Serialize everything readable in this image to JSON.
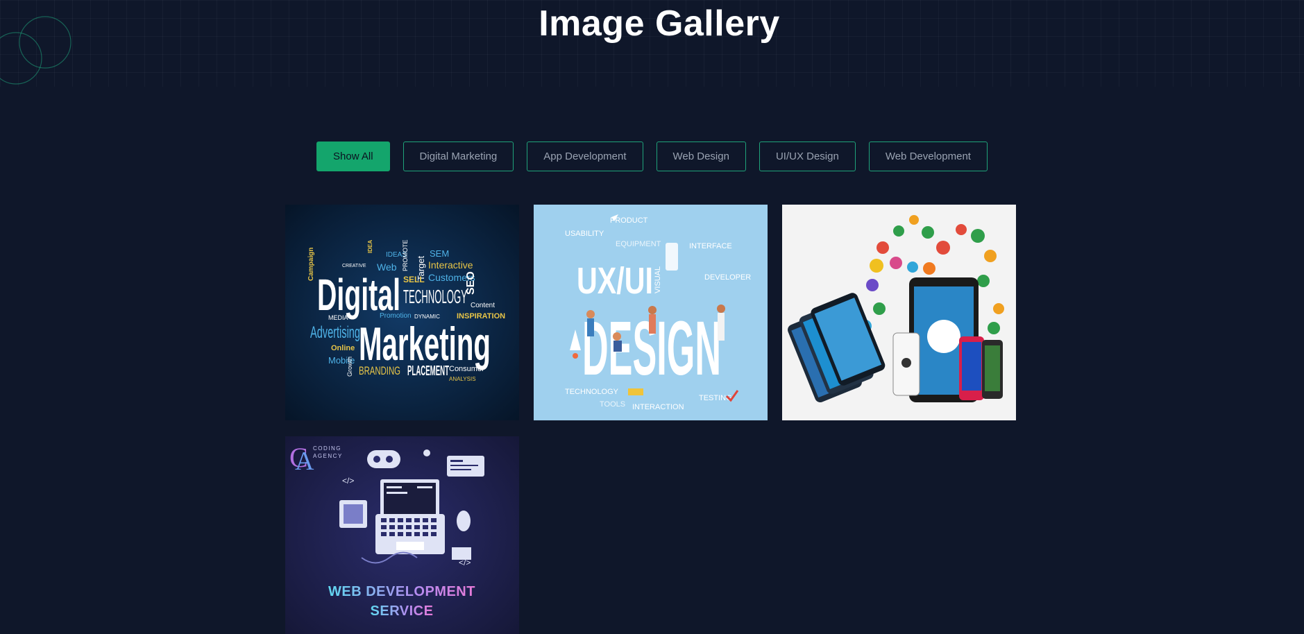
{
  "page": {
    "title": "Image Gallery"
  },
  "filters": [
    {
      "label": "Show All",
      "active": true
    },
    {
      "label": "Digital Marketing",
      "active": false
    },
    {
      "label": "App Development",
      "active": false
    },
    {
      "label": "Web Design",
      "active": false
    },
    {
      "label": "UI/UX Design",
      "active": false
    },
    {
      "label": "Web Development",
      "active": false
    }
  ],
  "gallery": [
    {
      "category": "Digital Marketing",
      "words": [
        "Digital",
        "Marketing",
        "TECHNOLOGY",
        "Advertising",
        "BRANDING",
        "PLACEMENT",
        "SEO",
        "Target",
        "Customers",
        "Interactive",
        "SEM",
        "Web",
        "IDEA",
        "SELL",
        "INSPIRATION",
        "Online",
        "Mobile",
        "Consumer",
        "MEDIA",
        "Campaign",
        "Promotion",
        "DYNAMIC",
        "Content",
        "CREATIVE",
        "IDEAS",
        "PROMOTE",
        "Growth",
        "ANALYSIS"
      ]
    },
    {
      "category": "UI/UX Design",
      "words": [
        "UX/UI",
        "DESIGN",
        "PRODUCT",
        "USABILITY",
        "EQUIPMENT",
        "INTERFACE",
        "DEVELOPER",
        "TECHNOLOGY",
        "TOOLS",
        "INTERACTION",
        "TESTING",
        "VISUAL"
      ]
    },
    {
      "category": "App Development",
      "words": []
    },
    {
      "category": "Web Development",
      "words": [
        "WEB DEVELOPMENT",
        "SERVICE",
        "CODING",
        "AGENCY"
      ]
    }
  ],
  "colors": {
    "background": "#0f172a",
    "accent": "#14a56c",
    "button_border": "#1fa37a",
    "button_text": "#9aa3b2"
  }
}
